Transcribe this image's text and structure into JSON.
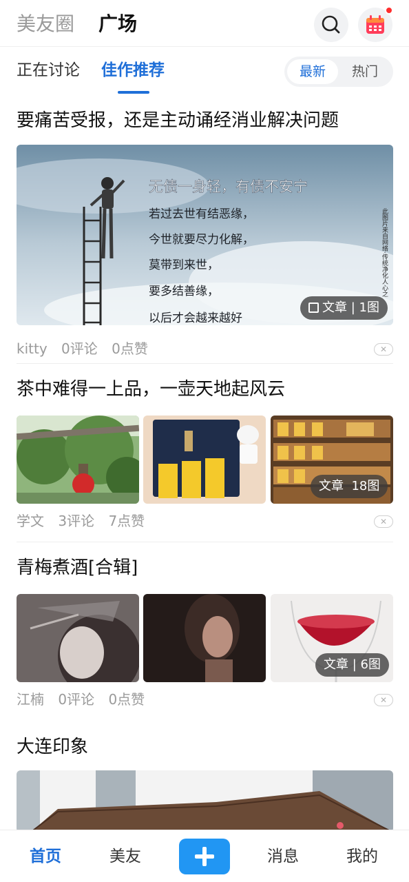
{
  "header": {
    "tabs": [
      {
        "label": "美友圈",
        "active": false
      },
      {
        "label": "广场",
        "active": true
      }
    ],
    "icons": [
      "search-icon",
      "calendar-icon"
    ],
    "has_notification_dot": true
  },
  "subtabs": {
    "tabs": [
      {
        "label": "正在讨论",
        "active": false
      },
      {
        "label": "佳作推荐",
        "active": true
      }
    ],
    "sort": {
      "latest": "最新",
      "hot": "热门",
      "selected": "最新"
    }
  },
  "posts": [
    {
      "title": "要痛苦受报，还是主动诵经消业解决问题",
      "image_text": {
        "line1": "无债一身轻，有债不安宁",
        "line2": "若过去世有结恶缘，",
        "line3": "今世就要尽力化解，",
        "line4": "莫带到来世，",
        "line5": "要多结善缘，",
        "line6": "以后才会越来越好",
        "side": "此图片来自网络·传统净化人心之"
      },
      "badge": {
        "type": "文章",
        "count": "1图"
      },
      "author": "kitty",
      "comments": "0评论",
      "likes": "0点赞"
    },
    {
      "title": "茶中难得一上品，一壶天地起风云",
      "badge": {
        "type": "文章",
        "count": "18图"
      },
      "author": "学文",
      "comments": "3评论",
      "likes": "7点赞"
    },
    {
      "title": "青梅煮酒[合辑]",
      "badge": {
        "type": "文章",
        "count": "6图"
      },
      "author": "江楠",
      "comments": "0评论",
      "likes": "0点赞"
    },
    {
      "title": "大连印象"
    }
  ],
  "bottom_nav": {
    "home": "首页",
    "friends": "美友",
    "add_icon": "plus-icon",
    "messages": "消息",
    "mine": "我的"
  },
  "colors": {
    "accent": "#1f6fd8",
    "add_button": "#2196f3",
    "notification": "#ff2d2d",
    "muted_text": "#9a9a9a"
  }
}
